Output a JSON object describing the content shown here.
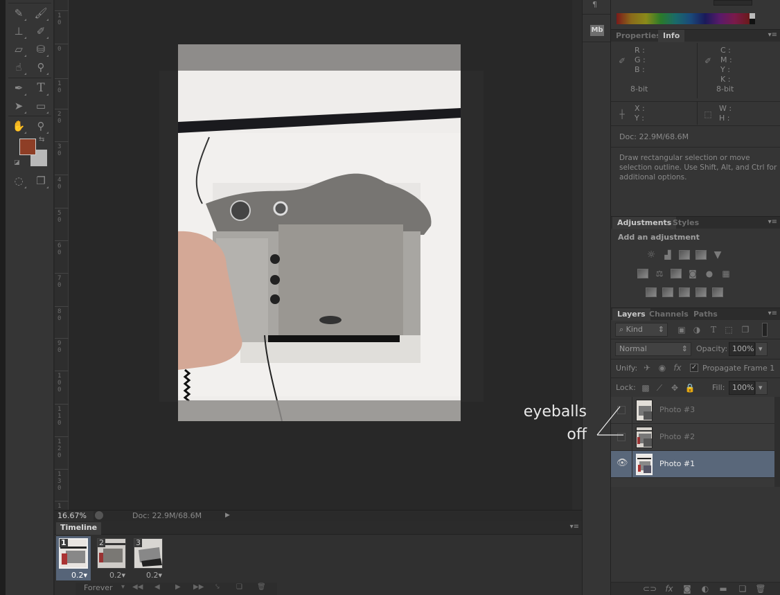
{
  "toolbar": {
    "tools": [
      {
        "name": "spot-healing-brush",
        "glyph": "✎"
      },
      {
        "name": "brush",
        "glyph": "🖌"
      },
      {
        "name": "clone-stamp",
        "glyph": "⊥"
      },
      {
        "name": "history-brush",
        "glyph": "✐"
      },
      {
        "name": "eraser",
        "glyph": "▱"
      },
      {
        "name": "paint-bucket",
        "glyph": "⛁"
      },
      {
        "name": "blur",
        "glyph": "☝"
      },
      {
        "name": "dodge",
        "glyph": "⚲"
      },
      {
        "name": "pen",
        "glyph": "✒"
      },
      {
        "name": "type",
        "glyph": "T"
      },
      {
        "name": "path-selection",
        "glyph": "➤"
      },
      {
        "name": "rectangle",
        "glyph": "▭"
      },
      {
        "name": "hand",
        "glyph": "✋"
      },
      {
        "name": "zoom",
        "glyph": "⚲"
      }
    ],
    "foreground_color": "#8e3e26",
    "background_color": "#b8b8b8",
    "quick_mask_glyph": "◌",
    "screen_mode_glyph": "❐"
  },
  "ruler": {
    "labels": [
      "1\n0",
      "0",
      "1\n0",
      "2\n0",
      "3\n0",
      "4\n0",
      "5\n0",
      "6\n0",
      "7\n0",
      "8\n0",
      "9\n0",
      "1\n0\n0",
      "1\n1\n0",
      "1\n2\n0",
      "1\n3\n0",
      "1"
    ]
  },
  "status": {
    "zoom": "16.67%",
    "doc": "Doc: 22.9M/68.6M"
  },
  "timeline": {
    "tab_label": "Timeline",
    "frames": [
      {
        "number": "1",
        "duration": "0.2▾",
        "selected": true
      },
      {
        "number": "2",
        "duration": "0.2▾",
        "selected": false
      },
      {
        "number": "3",
        "duration": "0.2▾",
        "selected": false
      }
    ],
    "loop": "Forever",
    "controls": {
      "first": "◀◀",
      "prev": "◀",
      "play": "▶",
      "next": "▶▶",
      "tween": "⤥",
      "duplicate": "❏",
      "delete": "🗑"
    }
  },
  "minidock": {
    "mb_label": "Mb"
  },
  "info_panel": {
    "tabs": [
      "Properties",
      "Info"
    ],
    "active_tab": "Info",
    "rgb_labels": [
      "R :",
      "G :",
      "B :"
    ],
    "cmyk_labels": [
      "C :",
      "M :",
      "Y :",
      "K :"
    ],
    "bit_depth_left": "8-bit",
    "bit_depth_right": "8-bit",
    "xy_labels": [
      "X :",
      "Y :"
    ],
    "wh_labels": [
      "W :",
      "H :"
    ],
    "doc": "Doc: 22.9M/68.6M",
    "hint": "Draw rectangular selection or move selection outline.  Use Shift, Alt, and Ctrl for additional options."
  },
  "adjustments_panel": {
    "tabs": [
      "Adjustments",
      "Styles"
    ],
    "title": "Add an adjustment",
    "rows": [
      [
        "brightness-contrast",
        "levels",
        "curves",
        "exposure",
        "vibrance"
      ],
      [
        "hue-saturation",
        "color-balance",
        "black-white",
        "photo-filter",
        "channel-mixer",
        "color-lookup"
      ],
      [
        "invert",
        "posterize",
        "threshold",
        "selective-color",
        "gradient-map"
      ]
    ]
  },
  "layers_panel": {
    "tabs": [
      "Layers",
      "Channels",
      "Paths"
    ],
    "filter": "Kind",
    "blend_mode": "Normal",
    "opacity_label": "Opacity:",
    "opacity": "100%",
    "unify_label": "Unify:",
    "propagate_label": "Propagate Frame 1",
    "propagate_checked": true,
    "lock_label": "Lock:",
    "fill_label": "Fill:",
    "fill": "100%",
    "layers": [
      {
        "name": "Photo #3",
        "visible": false,
        "selected": false
      },
      {
        "name": "Photo #2",
        "visible": false,
        "selected": false
      },
      {
        "name": "Photo #1",
        "visible": true,
        "selected": true
      }
    ],
    "footer_icons": [
      "link",
      "fx",
      "mask",
      "adjustment",
      "group",
      "new-layer",
      "delete"
    ]
  },
  "annotation": {
    "line1": "eyeballs",
    "line2": "off"
  },
  "colors": {
    "panel_bg": "#353535",
    "selection": "#59677a",
    "canvas_bg": "#282828"
  }
}
